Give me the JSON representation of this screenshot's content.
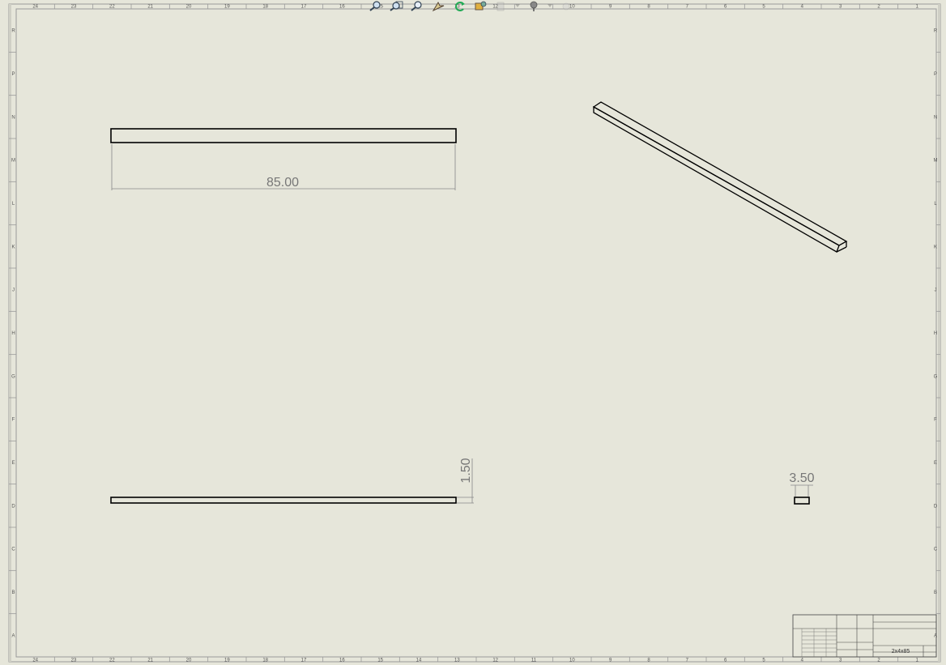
{
  "zones": {
    "top": [
      "24",
      "23",
      "22",
      "21",
      "20",
      "19",
      "18",
      "17",
      "16",
      "15",
      "14",
      "13",
      "12",
      "11",
      "10",
      "9",
      "8",
      "7",
      "6",
      "5",
      "4",
      "3",
      "2",
      "1"
    ],
    "bottom": [
      "24",
      "23",
      "22",
      "21",
      "20",
      "19",
      "18",
      "17",
      "16",
      "15",
      "14",
      "13",
      "12",
      "11",
      "10",
      "9",
      "8",
      "7",
      "6",
      "5",
      "4",
      "3",
      "2",
      "1"
    ],
    "left": [
      "R",
      "P",
      "N",
      "M",
      "L",
      "K",
      "J",
      "H",
      "G",
      "F",
      "E",
      "D",
      "C",
      "B",
      "A"
    ],
    "right": [
      "R",
      "P",
      "N",
      "M",
      "L",
      "K",
      "J",
      "H",
      "G",
      "F",
      "E",
      "D",
      "C",
      "B",
      "A"
    ]
  },
  "dimensions": {
    "length": "85.00",
    "thickness": "1.50",
    "width": "3.50"
  },
  "title_block": {
    "part_name": "2x4x85"
  },
  "toolbar": {
    "icons": [
      "zoom-to-fit-icon",
      "zoom-area-icon",
      "zoom-in-out-icon",
      "select-icon",
      "rotate-icon",
      "pan-icon",
      "hide-show-icon",
      "view-orientation-icon"
    ]
  },
  "colors": {
    "sheet_background": "#e6e6da",
    "line": "#000000",
    "dimension": "#777777",
    "border": "#9a9a9a"
  }
}
